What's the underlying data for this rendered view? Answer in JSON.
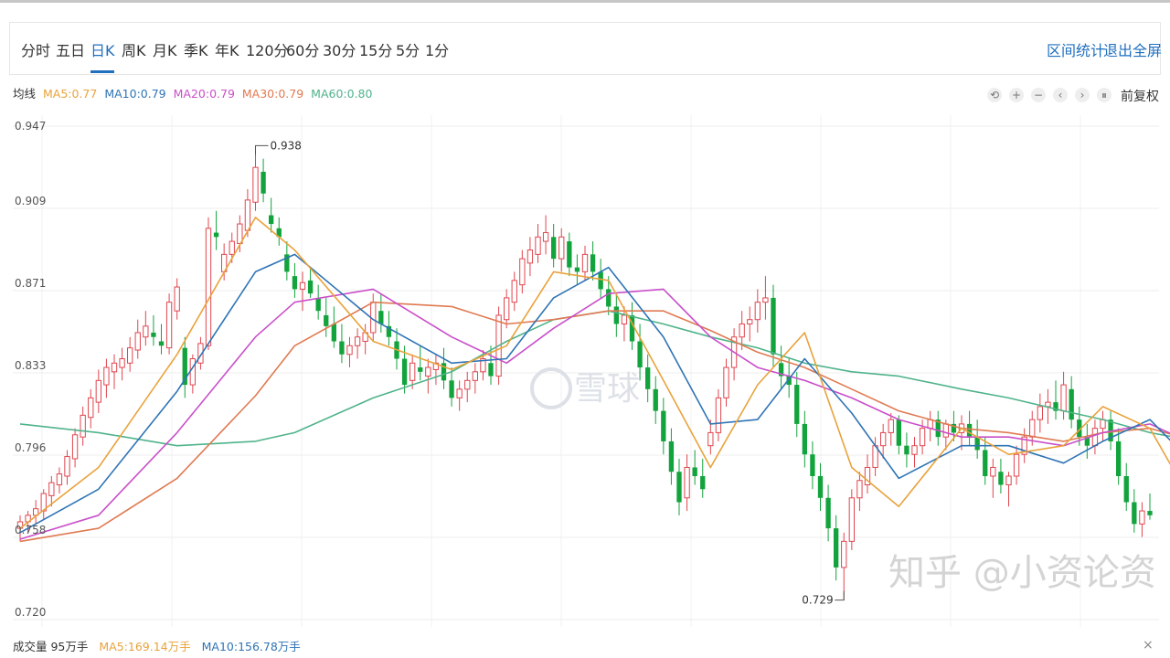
{
  "toolbar": {
    "periods": [
      "分时",
      "五日",
      "日K",
      "周K",
      "月K",
      "季K",
      "年K",
      "120分",
      "60分",
      "30分",
      "15分",
      "5分",
      "1分"
    ],
    "active_period": "日K",
    "range_stats": "区间统计",
    "exit_fullscreen": "退出全屏"
  },
  "legend": {
    "label": "均线",
    "ma5": "MA5:0.77",
    "ma10": "MA10:0.79",
    "ma20": "MA20:0.79",
    "ma30": "MA30:0.79",
    "ma60": "MA60:0.80"
  },
  "controls": {
    "icons": [
      "undo-icon",
      "plus-icon",
      "minus-icon",
      "chevron-left-icon",
      "chevron-right-icon",
      "pause-icon"
    ],
    "glyphs": [
      "⟲",
      "+",
      "−",
      "‹",
      "›",
      "⏸"
    ],
    "adjust_label": "前复权"
  },
  "volume": {
    "label": "成交量 95万手",
    "ma5": "MA5:169.14万手",
    "ma10": "MA10:156.78万手"
  },
  "watermark": {
    "logo_text": "雪球",
    "credit": "知乎 @小资论资"
  },
  "colors": {
    "up": "#e0464f",
    "down": "#12a33c",
    "ma5": "#e9a23b",
    "ma10": "#2f74b5",
    "ma20": "#c94fc9",
    "ma30": "#e07a52",
    "ma60": "#4fb38a",
    "accent": "#1f6fbf"
  },
  "chart_data": {
    "type": "candlestick",
    "ylim": [
      0.72,
      0.947
    ],
    "y_ticks": [
      "0.947",
      "0.909",
      "0.871",
      "0.833",
      "0.796",
      "0.758",
      "0.720"
    ],
    "annotations": {
      "high": "0.938",
      "low": "0.729"
    },
    "ohlc": [
      [
        0.762,
        0.768,
        0.756,
        0.765
      ],
      [
        0.765,
        0.77,
        0.76,
        0.768
      ],
      [
        0.768,
        0.775,
        0.764,
        0.771
      ],
      [
        0.77,
        0.78,
        0.766,
        0.778
      ],
      [
        0.777,
        0.786,
        0.772,
        0.783
      ],
      [
        0.782,
        0.79,
        0.778,
        0.787
      ],
      [
        0.786,
        0.798,
        0.782,
        0.795
      ],
      [
        0.794,
        0.808,
        0.79,
        0.805
      ],
      [
        0.804,
        0.818,
        0.8,
        0.814
      ],
      [
        0.813,
        0.826,
        0.808,
        0.822
      ],
      [
        0.82,
        0.835,
        0.815,
        0.83
      ],
      [
        0.828,
        0.84,
        0.822,
        0.836
      ],
      [
        0.834,
        0.842,
        0.826,
        0.838
      ],
      [
        0.836,
        0.845,
        0.83,
        0.84
      ],
      [
        0.838,
        0.85,
        0.834,
        0.845
      ],
      [
        0.844,
        0.858,
        0.84,
        0.852
      ],
      [
        0.85,
        0.862,
        0.846,
        0.855
      ],
      [
        0.852,
        0.86,
        0.846,
        0.85
      ],
      [
        0.848,
        0.856,
        0.842,
        0.846
      ],
      [
        0.845,
        0.87,
        0.842,
        0.866
      ],
      [
        0.862,
        0.877,
        0.858,
        0.873
      ],
      [
        0.845,
        0.85,
        0.822,
        0.828
      ],
      [
        0.828,
        0.842,
        0.824,
        0.84
      ],
      [
        0.838,
        0.85,
        0.835,
        0.847
      ],
      [
        0.846,
        0.905,
        0.844,
        0.9
      ],
      [
        0.898,
        0.908,
        0.89,
        0.896
      ],
      [
        0.88,
        0.893,
        0.876,
        0.888
      ],
      [
        0.888,
        0.898,
        0.884,
        0.894
      ],
      [
        0.893,
        0.906,
        0.889,
        0.902
      ],
      [
        0.899,
        0.918,
        0.896,
        0.913
      ],
      [
        0.912,
        0.938,
        0.908,
        0.928
      ],
      [
        0.926,
        0.932,
        0.912,
        0.916
      ],
      [
        0.906,
        0.914,
        0.898,
        0.902
      ],
      [
        0.9,
        0.905,
        0.892,
        0.896
      ],
      [
        0.888,
        0.894,
        0.876,
        0.88
      ],
      [
        0.878,
        0.884,
        0.868,
        0.872
      ],
      [
        0.872,
        0.88,
        0.862,
        0.875
      ],
      [
        0.876,
        0.882,
        0.868,
        0.87
      ],
      [
        0.868,
        0.874,
        0.858,
        0.862
      ],
      [
        0.86,
        0.868,
        0.85,
        0.855
      ],
      [
        0.856,
        0.864,
        0.845,
        0.848
      ],
      [
        0.848,
        0.856,
        0.838,
        0.842
      ],
      [
        0.842,
        0.85,
        0.836,
        0.846
      ],
      [
        0.846,
        0.854,
        0.84,
        0.85
      ],
      [
        0.848,
        0.856,
        0.842,
        0.852
      ],
      [
        0.852,
        0.87,
        0.848,
        0.866
      ],
      [
        0.862,
        0.87,
        0.852,
        0.856
      ],
      [
        0.855,
        0.862,
        0.846,
        0.85
      ],
      [
        0.848,
        0.854,
        0.835,
        0.84
      ],
      [
        0.84,
        0.846,
        0.824,
        0.828
      ],
      [
        0.83,
        0.842,
        0.826,
        0.838
      ],
      [
        0.836,
        0.846,
        0.83,
        0.834
      ],
      [
        0.832,
        0.84,
        0.824,
        0.836
      ],
      [
        0.835,
        0.842,
        0.828,
        0.838
      ],
      [
        0.838,
        0.845,
        0.826,
        0.83
      ],
      [
        0.83,
        0.836,
        0.818,
        0.822
      ],
      [
        0.822,
        0.83,
        0.816,
        0.826
      ],
      [
        0.826,
        0.834,
        0.82,
        0.83
      ],
      [
        0.83,
        0.838,
        0.824,
        0.834
      ],
      [
        0.834,
        0.844,
        0.83,
        0.84
      ],
      [
        0.838,
        0.846,
        0.828,
        0.832
      ],
      [
        0.832,
        0.864,
        0.828,
        0.86
      ],
      [
        0.858,
        0.872,
        0.854,
        0.868
      ],
      [
        0.866,
        0.88,
        0.862,
        0.876
      ],
      [
        0.874,
        0.89,
        0.87,
        0.886
      ],
      [
        0.884,
        0.896,
        0.878,
        0.89
      ],
      [
        0.888,
        0.902,
        0.884,
        0.896
      ],
      [
        0.894,
        0.906,
        0.888,
        0.898
      ],
      [
        0.896,
        0.902,
        0.882,
        0.886
      ],
      [
        0.886,
        0.9,
        0.88,
        0.896
      ],
      [
        0.894,
        0.898,
        0.878,
        0.882
      ],
      [
        0.882,
        0.888,
        0.874,
        0.88
      ],
      [
        0.88,
        0.892,
        0.876,
        0.888
      ],
      [
        0.888,
        0.894,
        0.876,
        0.88
      ],
      [
        0.88,
        0.886,
        0.868,
        0.872
      ],
      [
        0.872,
        0.878,
        0.86,
        0.864
      ],
      [
        0.864,
        0.87,
        0.85,
        0.856
      ],
      [
        0.856,
        0.864,
        0.848,
        0.86
      ],
      [
        0.86,
        0.866,
        0.844,
        0.848
      ],
      [
        0.848,
        0.856,
        0.83,
        0.836
      ],
      [
        0.836,
        0.842,
        0.82,
        0.826
      ],
      [
        0.826,
        0.832,
        0.81,
        0.816
      ],
      [
        0.816,
        0.822,
        0.796,
        0.802
      ],
      [
        0.802,
        0.808,
        0.782,
        0.788
      ],
      [
        0.788,
        0.794,
        0.768,
        0.774
      ],
      [
        0.776,
        0.796,
        0.77,
        0.79
      ],
      [
        0.79,
        0.798,
        0.782,
        0.786
      ],
      [
        0.786,
        0.794,
        0.776,
        0.78
      ],
      [
        0.8,
        0.812,
        0.796,
        0.806
      ],
      [
        0.806,
        0.826,
        0.802,
        0.822
      ],
      [
        0.822,
        0.84,
        0.818,
        0.836
      ],
      [
        0.836,
        0.854,
        0.83,
        0.85
      ],
      [
        0.85,
        0.862,
        0.844,
        0.856
      ],
      [
        0.856,
        0.864,
        0.848,
        0.858
      ],
      [
        0.858,
        0.872,
        0.852,
        0.866
      ],
      [
        0.866,
        0.878,
        0.858,
        0.868
      ],
      [
        0.868,
        0.874,
        0.836,
        0.842
      ],
      [
        0.838,
        0.846,
        0.826,
        0.832
      ],
      [
        0.832,
        0.84,
        0.822,
        0.828
      ],
      [
        0.828,
        0.834,
        0.804,
        0.81
      ],
      [
        0.81,
        0.816,
        0.79,
        0.796
      ],
      [
        0.796,
        0.802,
        0.78,
        0.786
      ],
      [
        0.786,
        0.792,
        0.77,
        0.776
      ],
      [
        0.776,
        0.782,
        0.756,
        0.762
      ],
      [
        0.762,
        0.768,
        0.738,
        0.744
      ],
      [
        0.744,
        0.76,
        0.729,
        0.756
      ],
      [
        0.756,
        0.78,
        0.752,
        0.776
      ],
      [
        0.776,
        0.788,
        0.77,
        0.784
      ],
      [
        0.782,
        0.796,
        0.778,
        0.79
      ],
      [
        0.79,
        0.804,
        0.786,
        0.8
      ],
      [
        0.8,
        0.81,
        0.794,
        0.806
      ],
      [
        0.806,
        0.815,
        0.8,
        0.812
      ],
      [
        0.812,
        0.814,
        0.796,
        0.8
      ],
      [
        0.8,
        0.806,
        0.79,
        0.796
      ],
      [
        0.796,
        0.804,
        0.79,
        0.8
      ],
      [
        0.8,
        0.812,
        0.796,
        0.808
      ],
      [
        0.808,
        0.816,
        0.802,
        0.812
      ],
      [
        0.812,
        0.816,
        0.8,
        0.804
      ],
      [
        0.804,
        0.812,
        0.798,
        0.81
      ],
      [
        0.81,
        0.816,
        0.802,
        0.806
      ],
      [
        0.806,
        0.814,
        0.798,
        0.81
      ],
      [
        0.81,
        0.816,
        0.8,
        0.804
      ],
      [
        0.804,
        0.812,
        0.794,
        0.798
      ],
      [
        0.798,
        0.804,
        0.782,
        0.786
      ],
      [
        0.786,
        0.794,
        0.776,
        0.79
      ],
      [
        0.788,
        0.794,
        0.778,
        0.782
      ],
      [
        0.782,
        0.788,
        0.772,
        0.786
      ],
      [
        0.786,
        0.8,
        0.782,
        0.796
      ],
      [
        0.796,
        0.808,
        0.792,
        0.804
      ],
      [
        0.804,
        0.816,
        0.8,
        0.812
      ],
      [
        0.812,
        0.824,
        0.806,
        0.818
      ],
      [
        0.818,
        0.826,
        0.81,
        0.82
      ],
      [
        0.82,
        0.83,
        0.812,
        0.816
      ],
      [
        0.816,
        0.834,
        0.812,
        0.828
      ],
      [
        0.826,
        0.832,
        0.808,
        0.812
      ],
      [
        0.812,
        0.818,
        0.8,
        0.804
      ],
      [
        0.804,
        0.81,
        0.794,
        0.8
      ],
      [
        0.8,
        0.812,
        0.796,
        0.808
      ],
      [
        0.808,
        0.816,
        0.802,
        0.812
      ],
      [
        0.812,
        0.816,
        0.798,
        0.802
      ],
      [
        0.802,
        0.808,
        0.782,
        0.786
      ],
      [
        0.786,
        0.792,
        0.77,
        0.774
      ],
      [
        0.774,
        0.78,
        0.76,
        0.764
      ],
      [
        0.764,
        0.774,
        0.758,
        0.77
      ],
      [
        0.77,
        0.778,
        0.766,
        0.768
      ]
    ],
    "ma_lines": {
      "ma5": [
        [
          0,
          0.762
        ],
        [
          10,
          0.79
        ],
        [
          20,
          0.842
        ],
        [
          30,
          0.905
        ],
        [
          35,
          0.89
        ],
        [
          45,
          0.848
        ],
        [
          55,
          0.835
        ],
        [
          62,
          0.846
        ],
        [
          68,
          0.88
        ],
        [
          75,
          0.876
        ],
        [
          82,
          0.83
        ],
        [
          88,
          0.79
        ],
        [
          94,
          0.828
        ],
        [
          100,
          0.852
        ],
        [
          106,
          0.79
        ],
        [
          112,
          0.772
        ],
        [
          120,
          0.808
        ],
        [
          126,
          0.796
        ],
        [
          133,
          0.8
        ],
        [
          138,
          0.818
        ],
        [
          144,
          0.808
        ],
        [
          150,
          0.77
        ]
      ],
      "ma10": [
        [
          0,
          0.76
        ],
        [
          10,
          0.78
        ],
        [
          20,
          0.825
        ],
        [
          30,
          0.88
        ],
        [
          35,
          0.888
        ],
        [
          45,
          0.858
        ],
        [
          55,
          0.838
        ],
        [
          62,
          0.84
        ],
        [
          68,
          0.868
        ],
        [
          75,
          0.882
        ],
        [
          82,
          0.85
        ],
        [
          88,
          0.81
        ],
        [
          94,
          0.812
        ],
        [
          100,
          0.84
        ],
        [
          106,
          0.815
        ],
        [
          112,
          0.785
        ],
        [
          120,
          0.8
        ],
        [
          126,
          0.8
        ],
        [
          133,
          0.792
        ],
        [
          138,
          0.802
        ],
        [
          144,
          0.812
        ],
        [
          150,
          0.79
        ]
      ],
      "ma20": [
        [
          0,
          0.757
        ],
        [
          10,
          0.768
        ],
        [
          20,
          0.806
        ],
        [
          30,
          0.85
        ],
        [
          35,
          0.866
        ],
        [
          45,
          0.872
        ],
        [
          55,
          0.85
        ],
        [
          62,
          0.838
        ],
        [
          68,
          0.854
        ],
        [
          75,
          0.87
        ],
        [
          82,
          0.872
        ],
        [
          88,
          0.85
        ],
        [
          94,
          0.836
        ],
        [
          100,
          0.83
        ],
        [
          106,
          0.822
        ],
        [
          112,
          0.812
        ],
        [
          120,
          0.804
        ],
        [
          126,
          0.804
        ],
        [
          133,
          0.8
        ],
        [
          138,
          0.806
        ],
        [
          144,
          0.81
        ],
        [
          150,
          0.8
        ]
      ],
      "ma30": [
        [
          0,
          0.756
        ],
        [
          10,
          0.762
        ],
        [
          20,
          0.785
        ],
        [
          30,
          0.823
        ],
        [
          35,
          0.846
        ],
        [
          45,
          0.866
        ],
        [
          55,
          0.864
        ],
        [
          62,
          0.856
        ],
        [
          68,
          0.858
        ],
        [
          75,
          0.862
        ],
        [
          82,
          0.862
        ],
        [
          88,
          0.853
        ],
        [
          94,
          0.843
        ],
        [
          100,
          0.836
        ],
        [
          106,
          0.826
        ],
        [
          112,
          0.816
        ],
        [
          120,
          0.808
        ],
        [
          126,
          0.806
        ],
        [
          133,
          0.802
        ],
        [
          138,
          0.806
        ],
        [
          144,
          0.808
        ],
        [
          150,
          0.802
        ]
      ],
      "ma60": [
        [
          0,
          0.81
        ],
        [
          10,
          0.806
        ],
        [
          20,
          0.8
        ],
        [
          30,
          0.802
        ],
        [
          35,
          0.806
        ],
        [
          45,
          0.822
        ],
        [
          55,
          0.834
        ],
        [
          62,
          0.848
        ],
        [
          68,
          0.858
        ],
        [
          75,
          0.862
        ],
        [
          82,
          0.856
        ],
        [
          88,
          0.85
        ],
        [
          94,
          0.845
        ],
        [
          100,
          0.838
        ],
        [
          106,
          0.834
        ],
        [
          112,
          0.832
        ],
        [
          120,
          0.826
        ],
        [
          126,
          0.822
        ],
        [
          133,
          0.816
        ],
        [
          138,
          0.812
        ],
        [
          144,
          0.806
        ],
        [
          150,
          0.802
        ]
      ]
    }
  }
}
